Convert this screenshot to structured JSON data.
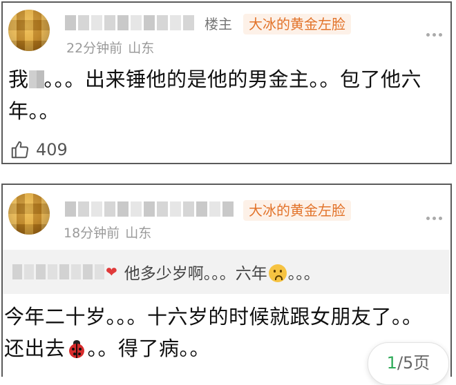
{
  "comments": [
    {
      "role": "楼主",
      "badge": "大冰的黄金左脸",
      "time": "22分钟前",
      "location": "山东",
      "text_start": "我",
      "text_end": "。。。出来锤他的是他的男金主。。包了他六年。。",
      "likes": "409"
    },
    {
      "badge": "大冰的黄金左脸",
      "time": "18分钟前",
      "location": "山东",
      "quote_start": "他多少岁啊。。。六年",
      "quote_end": "。。。",
      "text_line1": "今年二十岁。。。十六岁的时候就跟女朋友了。。",
      "text_line2_start": "还出去",
      "text_line2_end": "。。得了病。。"
    }
  ],
  "pager": {
    "current": "1",
    "total": "/5页"
  },
  "colors": {
    "badge_text": "#e2732a",
    "badge_bg": "#fdf1e8",
    "pager_current": "#2eaa58"
  },
  "icons": [
    "avatar",
    "more-dots-icon",
    "thumbs-up-icon",
    "sad-face-emoji",
    "ladybug-emoji",
    "heart-icon"
  ]
}
